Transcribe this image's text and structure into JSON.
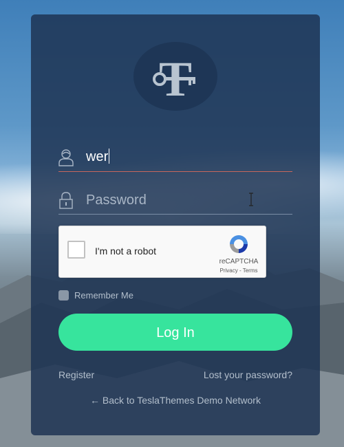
{
  "logo": {
    "letter": "T"
  },
  "username": {
    "value": "wer",
    "icon": "user-icon"
  },
  "password": {
    "placeholder": "Password",
    "icon": "lock-icon"
  },
  "captcha": {
    "label": "I'm not a robot",
    "brand": "reCAPTCHA",
    "links": "Privacy - Terms"
  },
  "remember": {
    "label": "Remember Me"
  },
  "login": {
    "label": "Log In"
  },
  "links": {
    "register": "Register",
    "lost_password": "Lost your password?",
    "back": "← Back to TeslaThemes Demo Network"
  },
  "colors": {
    "panel": "#1e3454",
    "accent": "#37e49d",
    "active_underline": "#c9675c"
  }
}
